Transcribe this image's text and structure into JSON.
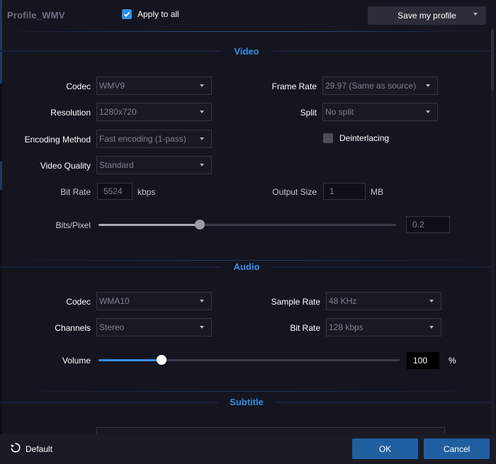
{
  "header": {
    "profile_title": "Profile_WMV",
    "apply_to_all_label": "Apply to all",
    "apply_to_all_checked": true,
    "save_profile_label": "Save my profile"
  },
  "video": {
    "section_title": "Video",
    "codec_label": "Codec",
    "codec_value": "WMV9",
    "frame_rate_label": "Frame Rate",
    "frame_rate_value": "29.97 (Same as source)",
    "resolution_label": "Resolution",
    "resolution_value": "1280x720",
    "split_label": "Split",
    "split_value": "No split",
    "encoding_method_label": "Encoding Method",
    "encoding_method_value": "Fast encoding (1-pass)",
    "deinterlacing_label": "Deinterlacing",
    "deinterlacing_checked": false,
    "video_quality_label": "Video Quality",
    "video_quality_value": "Standard",
    "bit_rate_label": "Bit Rate",
    "bit_rate_value": "5524",
    "bit_rate_unit": "kbps",
    "output_size_label": "Output Size",
    "output_size_value": "1",
    "output_size_unit": "MB",
    "bits_pixel_label": "Bits/Pixel",
    "bits_pixel_value": "0.2",
    "bits_pixel_slider_fraction": 0.34
  },
  "audio": {
    "section_title": "Audio",
    "codec_label": "Codec",
    "codec_value": "WMA10",
    "sample_rate_label": "Sample Rate",
    "sample_rate_value": "48 KHz",
    "channels_label": "Channels",
    "channels_value": "Stereo",
    "bit_rate_label": "Bit Rate",
    "bit_rate_value": "128 kbps",
    "volume_label": "Volume",
    "volume_value": "100",
    "volume_unit": "%",
    "volume_slider_fraction": 0.21
  },
  "subtitle": {
    "section_title": "Subtitle"
  },
  "footer": {
    "default_label": "Default",
    "ok_label": "OK",
    "cancel_label": "Cancel"
  },
  "colors": {
    "accent": "#3a8ee6",
    "button": "#1f5fa0",
    "background": "#14151f",
    "slider_knob": "#c8c8cc"
  }
}
